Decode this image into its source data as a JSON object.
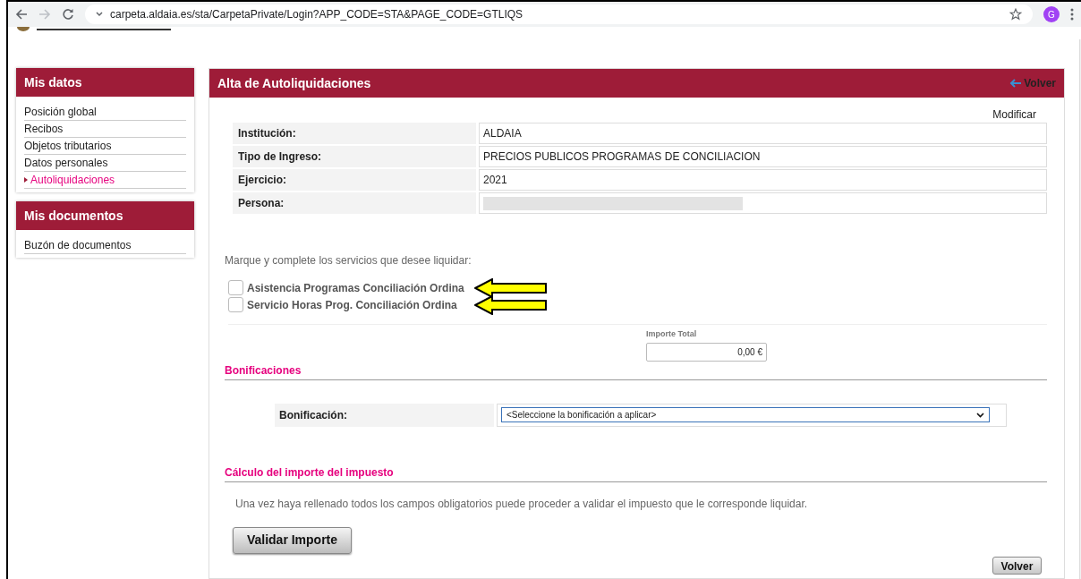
{
  "browser": {
    "url": "carpeta.aldaia.es/sta/CarpetaPrivate/Login?APP_CODE=STA&PAGE_CODE=GTLIQS",
    "avatar": "G"
  },
  "sidebar": [
    {
      "title": "Mis datos",
      "items": [
        {
          "label": "Posición global",
          "selected": false
        },
        {
          "label": "Recibos",
          "selected": false
        },
        {
          "label": "Objetos tributarios",
          "selected": false
        },
        {
          "label": "Datos personales",
          "selected": false
        },
        {
          "label": "Autoliquidaciones",
          "selected": true
        }
      ]
    },
    {
      "title": "Mis documentos",
      "items": [
        {
          "label": "Buzón de documentos",
          "selected": false
        }
      ]
    }
  ],
  "main": {
    "title": "Alta de Autoliquidaciones",
    "back_link": "Volver",
    "modify_link": "Modificar",
    "details": [
      {
        "label": "Institución:",
        "value": "ALDAIA",
        "redacted": false
      },
      {
        "label": "Tipo de Ingreso:",
        "value": "PRECIOS PUBLICOS PROGRAMAS DE CONCILIACION",
        "redacted": false
      },
      {
        "label": "Ejercicio:",
        "value": "2021",
        "redacted": false
      },
      {
        "label": "Persona:",
        "redacted": true
      }
    ],
    "services_prompt": "Marque y complete los servicios que desee liquidar:",
    "services": [
      {
        "label": "Asistencia Programas Conciliación Ordina",
        "checked": false
      },
      {
        "label": "Servicio Horas Prog. Conciliación Ordina",
        "checked": false
      }
    ],
    "total": {
      "label": "Importe Total",
      "value": "0,00 €"
    },
    "bonus_section": {
      "title": "Bonificaciones",
      "label": "Bonificación:",
      "select": "<Seleccione la bonificación a aplicar>"
    },
    "calc_section": {
      "title": "Cálculo del importe del impuesto",
      "text": "Una vez haya rellenado todos los campos obligatorios puede proceder a validar el impuesto que le corresponde liquidar.",
      "button": "Validar Importe"
    },
    "bottom_button": "Volver"
  }
}
